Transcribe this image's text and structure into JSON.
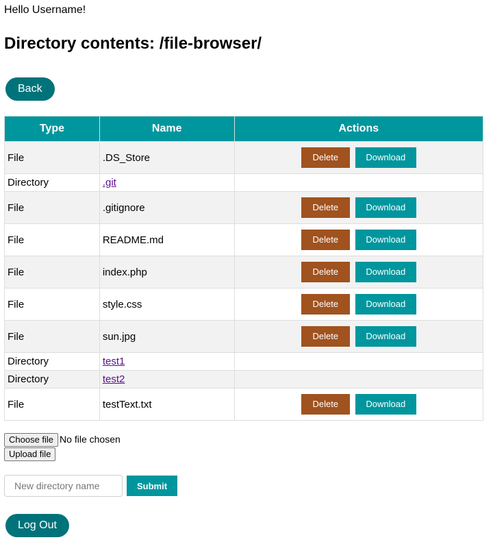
{
  "header": {
    "greeting": "Hello Username!",
    "title": "Directory contents: /file-browser/"
  },
  "nav": {
    "back_label": "Back"
  },
  "table": {
    "columns": [
      "Type",
      "Name",
      "Actions"
    ],
    "delete_label": "Delete",
    "download_label": "Download",
    "rows": [
      {
        "type": "File",
        "name": ".DS_Store"
      },
      {
        "type": "Directory",
        "name": ".git"
      },
      {
        "type": "File",
        "name": ".gitignore"
      },
      {
        "type": "File",
        "name": "README.md"
      },
      {
        "type": "File",
        "name": "index.php"
      },
      {
        "type": "File",
        "name": "style.css"
      },
      {
        "type": "File",
        "name": "sun.jpg"
      },
      {
        "type": "Directory",
        "name": "test1"
      },
      {
        "type": "Directory",
        "name": "test2"
      },
      {
        "type": "File",
        "name": "testText.txt"
      }
    ]
  },
  "upload": {
    "choose_label": "Choose file",
    "no_file_text": "No file chosen",
    "upload_label": "Upload file"
  },
  "new_directory": {
    "placeholder": "New directory name",
    "value": "",
    "submit_label": "Submit"
  },
  "footer": {
    "logout_label": "Log Out"
  },
  "colors": {
    "header_bg": "#00969e",
    "pill_bg": "#00737a",
    "delete_bg": "#a0521f",
    "download_bg": "#00969e",
    "link": "#5a0f8c"
  }
}
